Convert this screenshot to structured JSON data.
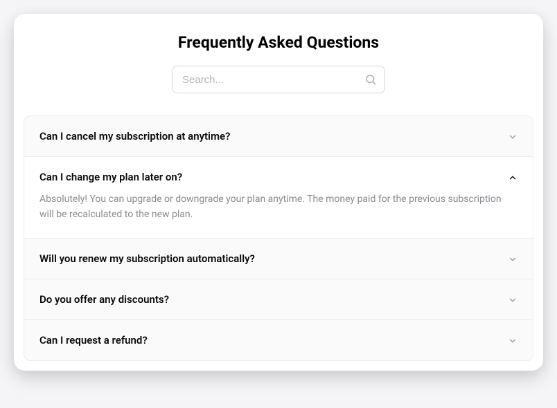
{
  "title": "Frequently Asked Questions",
  "search": {
    "placeholder": "Search..."
  },
  "faqs": [
    {
      "question": "Can I cancel my subscription at anytime?",
      "expanded": false
    },
    {
      "question": "Can I change my plan later on?",
      "answer": "Absolutely! You can upgrade or downgrade your plan anytime. The money paid for the previous subscription will be recalculated to the new plan.",
      "expanded": true
    },
    {
      "question": "Will you renew my subscription automatically?",
      "expanded": false
    },
    {
      "question": "Do you offer any discounts?",
      "expanded": false
    },
    {
      "question": "Can I request a refund?",
      "expanded": false
    }
  ]
}
